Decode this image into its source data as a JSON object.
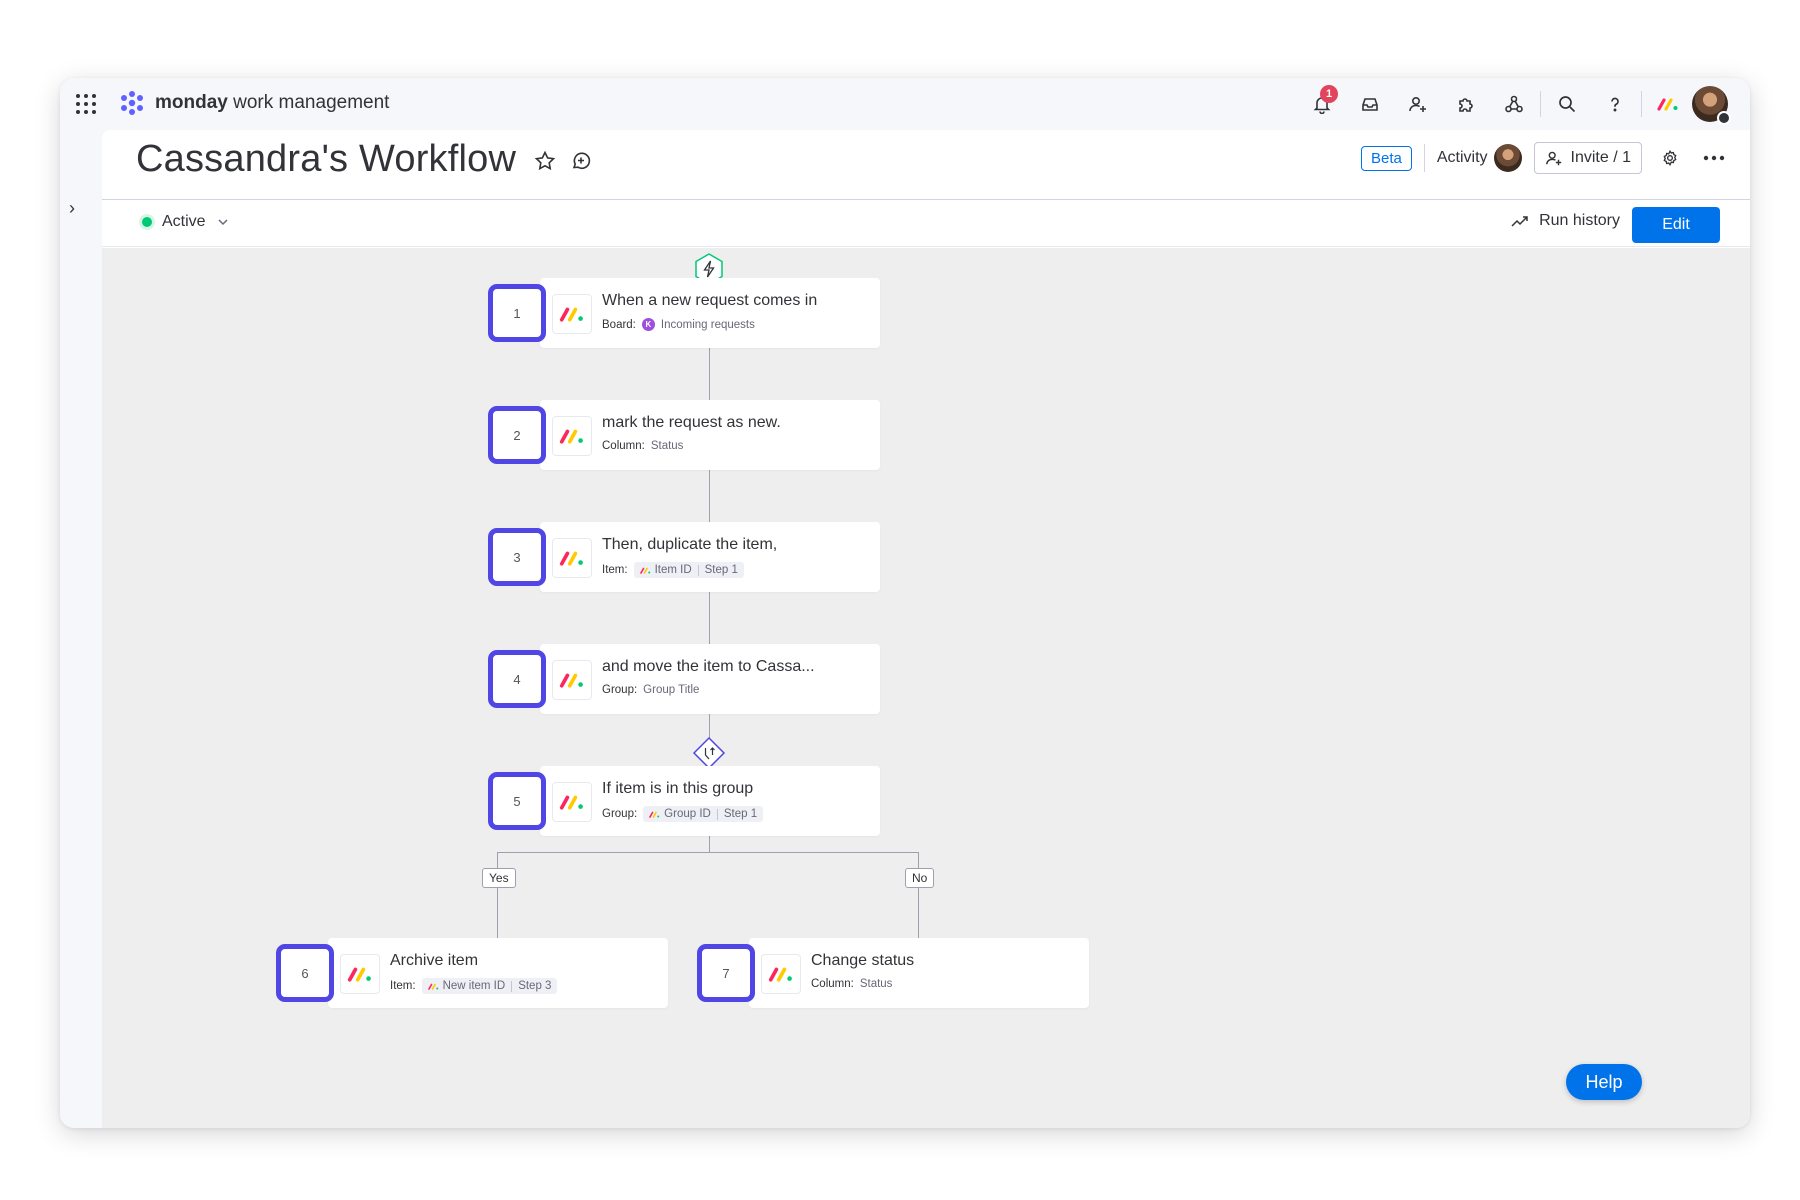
{
  "app": {
    "brand_bold": "monday",
    "brand_rest": "work management",
    "notification_count": "1"
  },
  "header": {
    "title": "Cassandra's Workflow",
    "beta_label": "Beta",
    "activity_label": "Activity",
    "invite_label": "Invite / 1"
  },
  "subbar": {
    "status": "Active",
    "run_history_label": "Run history",
    "edit_label": "Edit"
  },
  "nodes": [
    {
      "num": "1",
      "title": "When a new request comes in",
      "sub_label": "Board:",
      "sub_value": "Incoming requests",
      "sub_badge": "K"
    },
    {
      "num": "2",
      "title": "mark the request as new.",
      "sub_label": "Column:",
      "sub_value": "Status"
    },
    {
      "num": "3",
      "title": "Then, duplicate the item,",
      "sub_label": "Item:",
      "chip_a": "Item ID",
      "chip_b": "Step 1"
    },
    {
      "num": "4",
      "title": "and move the item to Cassa...",
      "sub_label": "Group:",
      "sub_value": "Group Title"
    },
    {
      "num": "5",
      "title": "If item is in this group",
      "sub_label": "Group:",
      "chip_a": "Group ID",
      "chip_b": "Step 1"
    },
    {
      "num": "6",
      "title": "Archive item",
      "sub_label": "Item:",
      "chip_a": "New item ID",
      "chip_b": "Step 3"
    },
    {
      "num": "7",
      "title": "Change status",
      "sub_label": "Column:",
      "sub_value": "Status"
    }
  ],
  "branches": {
    "yes": "Yes",
    "no": "No"
  },
  "help_label": "Help",
  "colors": {
    "accent": "#0073ea",
    "step_outline": "#4f46e5",
    "active": "#00c875",
    "badge": "#e2445c"
  }
}
